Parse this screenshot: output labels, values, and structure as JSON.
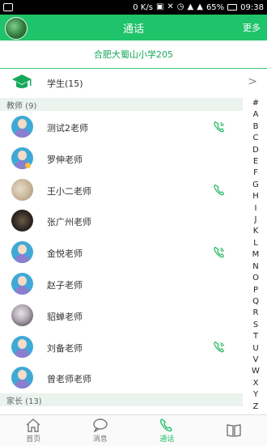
{
  "status_bar": {
    "left_icon": "app-icon",
    "speed": "0 K/s",
    "battery": "65%",
    "time": "09:38"
  },
  "header": {
    "title": "通话",
    "more": "更多"
  },
  "school": {
    "name": "合肥大蜀山小学205"
  },
  "students": {
    "label": "学生(15)"
  },
  "sections": {
    "teachers": "教师 (9)",
    "parents": "家长 (13)"
  },
  "teachers": [
    {
      "name": "测试2老师",
      "avatar": "default",
      "phone": "phone-wave-icon"
    },
    {
      "name": "罗伸老师",
      "avatar": "default",
      "badge": true
    },
    {
      "name": "王小二老师",
      "avatar": "photo1",
      "phone": "phone-icon"
    },
    {
      "name": "张广州老师",
      "avatar": "photo2"
    },
    {
      "name": "金悦老师",
      "avatar": "default",
      "phone": "phone-wave-icon"
    },
    {
      "name": "赵子老师",
      "avatar": "default"
    },
    {
      "name": "貂蝉老师",
      "avatar": "photo3"
    },
    {
      "name": "刘备老师",
      "avatar": "default",
      "phone": "phone-wave-icon"
    },
    {
      "name": "曾老师老师",
      "avatar": "default"
    }
  ],
  "index": [
    "#",
    "A",
    "B",
    "C",
    "D",
    "E",
    "F",
    "G",
    "H",
    "I",
    "J",
    "K",
    "L",
    "M",
    "N",
    "O",
    "P",
    "Q",
    "R",
    "S",
    "T",
    "U",
    "V",
    "W",
    "X",
    "Y",
    "Z"
  ],
  "bottom_nav": [
    {
      "label": "首页",
      "icon": "home-icon"
    },
    {
      "label": "消息",
      "icon": "message-icon"
    },
    {
      "label": "通话",
      "icon": "phone-icon",
      "active": true
    },
    {
      "label": "",
      "icon": "book-icon"
    }
  ],
  "colors": {
    "brand": "#1fc36a",
    "section_bg": "#eaf3ee"
  }
}
